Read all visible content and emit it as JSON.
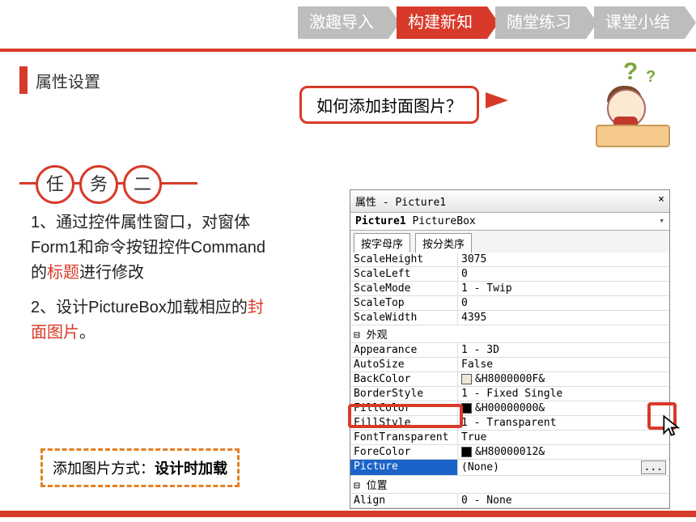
{
  "nav": {
    "t1": "激趣导入",
    "t2": "构建新知",
    "t3": "随堂练习",
    "t4": "课堂小结"
  },
  "section_title": "属性设置",
  "callout": "如何添加封面图片？",
  "task": {
    "c1": "任",
    "c2": "务",
    "c3": "二",
    "p1a": "1、通过控件属性窗口，对窗体Form1和命令按钮控件Command的",
    "p1b": "标题",
    "p1c": "进行修改",
    "p2a": "2、设计PictureBox加载相应的",
    "p2b": "封面图片",
    "p2c": "。"
  },
  "dashed": {
    "a": "添加图片方式：",
    "b": "设计时加载"
  },
  "prop": {
    "title": "属性 - Picture1",
    "close": "×",
    "combo_name": "Picture1",
    "combo_type": "PictureBox",
    "tab1": "按字母序",
    "tab2": "按分类序",
    "rows": {
      "scaleheight_k": "ScaleHeight",
      "scaleheight_v": "3075",
      "scaleleft_k": "ScaleLeft",
      "scaleleft_v": "0",
      "scalemode_k": "ScaleMode",
      "scalemode_v": "1 - Twip",
      "scaletop_k": "ScaleTop",
      "scaletop_v": "0",
      "scalewidth_k": "ScaleWidth",
      "scalewidth_v": "4395",
      "group_appearance": "⊟ 外观",
      "appearance_k": "Appearance",
      "appearance_v": "1 - 3D",
      "autosize_k": "AutoSize",
      "autosize_v": "False",
      "backcolor_k": "BackColor",
      "backcolor_v": "&H8000000F&",
      "borderstyle_k": "BorderStyle",
      "borderstyle_v": "1 - Fixed Single",
      "fillcolor_k": "FillColor",
      "fillcolor_v": "&H00000000&",
      "fillstyle_k": "FillStyle",
      "fillstyle_v": "1 - Transparent",
      "fonttransparent_k": "FontTransparent",
      "fonttransparent_v": "True",
      "forecolor_k": "ForeColor",
      "forecolor_v": "&H80000012&",
      "picture_k": "Picture",
      "picture_v": "(None)",
      "ellipsis": "...",
      "group_position": "⊟ 位置",
      "align_k": "Align",
      "align_v": "0 - None"
    }
  }
}
